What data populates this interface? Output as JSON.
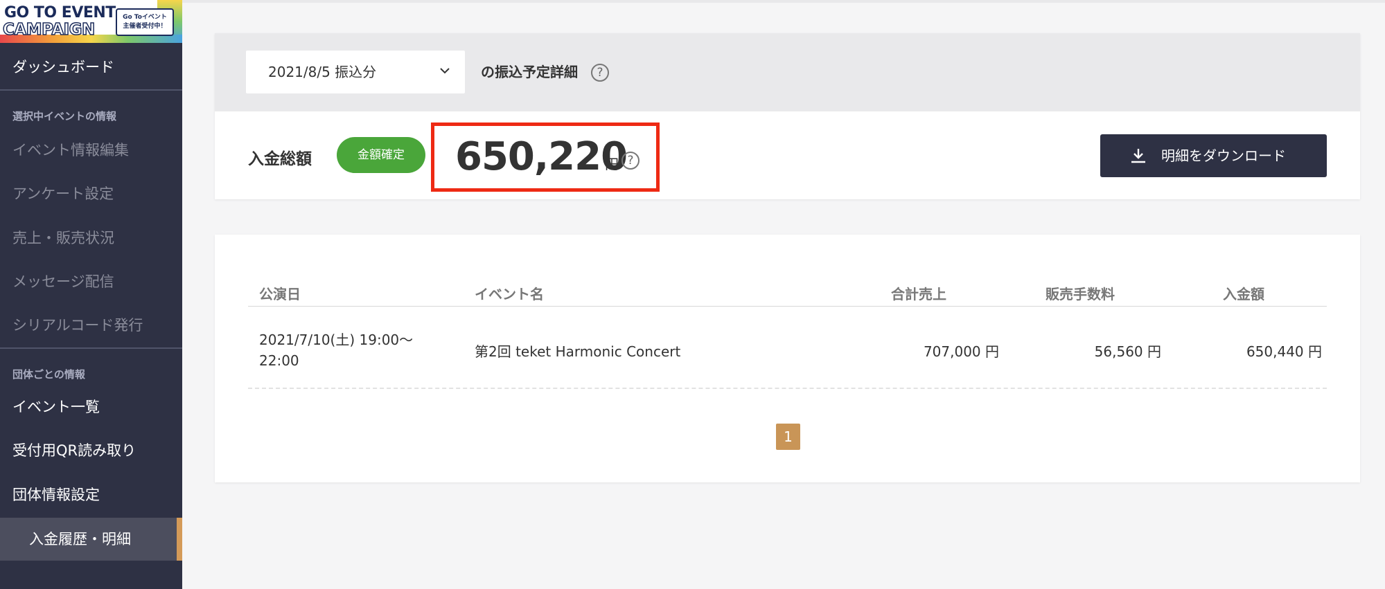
{
  "sidebar": {
    "banner": {
      "line1": "GO TO EVENT",
      "line2": "CAMPAIGN",
      "badge_line1": "Go Toイベント",
      "badge_line2": "主催者受付中！"
    },
    "dashboard": "ダッシュボード",
    "section_event": "選択中イベントの情報",
    "event_items": [
      "イベント情報編集",
      "アンケート設定",
      "売上・販売状況",
      "メッセージ配信",
      "シリアルコード発行"
    ],
    "section_group": "団体ごとの情報",
    "group_items": [
      "イベント一覧",
      "受付用QR読み取り",
      "団体情報設定"
    ],
    "active_item": "入金履歴・明細",
    "colors": {
      "bg": "#2e3144",
      "active_accent": "#d49a58"
    }
  },
  "summary": {
    "select_value": "2021/8/5 振込分",
    "heading": "の振込予定詳細",
    "help_icon": "question-circle-icon",
    "total_label": "入金総額",
    "status_badge": "金額確定",
    "amount": "650,220",
    "amount_unit": "円",
    "download_label": "明細をダウンロード",
    "download_icon": "download-icon",
    "colors": {
      "badge": "#4aa63a",
      "highlight_box": "#ee2a14",
      "button": "#2e3144"
    }
  },
  "table": {
    "columns": [
      "公演日",
      "イベント名",
      "合計売上",
      "販売手数料",
      "入金額"
    ],
    "rows": [
      {
        "date_line1": "2021/7/10(土) 19:00〜",
        "date_line2": "22:00",
        "event_name": "第2回 teket Harmonic Concert",
        "total_sales": "707,000 円",
        "fee": "56,560 円",
        "deposit": "650,440 円"
      }
    ],
    "pagination": {
      "current_page": "1",
      "color": "#c99557"
    }
  }
}
